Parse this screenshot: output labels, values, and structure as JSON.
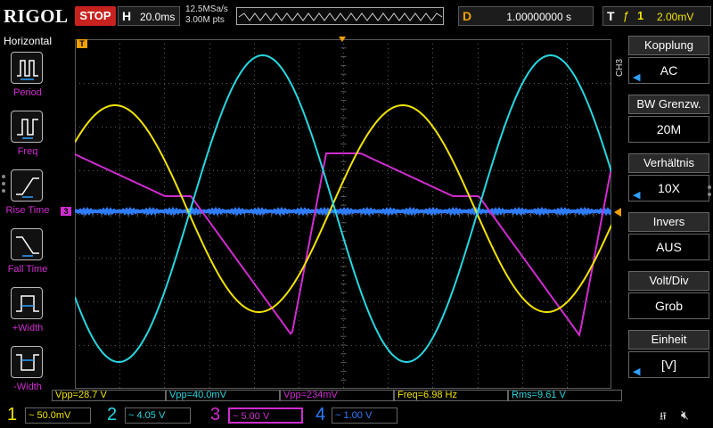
{
  "brand": "RIGOL",
  "status": "STOP",
  "horizontal": {
    "key": "H",
    "timebase": "20.0ms"
  },
  "acquisition": {
    "sample_rate": "12.5MSa/s",
    "mem_depth": "3.00M pts"
  },
  "delay": {
    "key": "D",
    "value": "1.00000000 s"
  },
  "trigger": {
    "key": "T",
    "slope": "ƒ",
    "source": "1",
    "level": "2.00mV"
  },
  "left_menu": {
    "title": "Horizontal",
    "items": [
      {
        "label": "Period",
        "icon": "period-icon"
      },
      {
        "label": "Freq",
        "icon": "freq-icon"
      },
      {
        "label": "Rise Time",
        "icon": "rise-time-icon"
      },
      {
        "label": "Fall Time",
        "icon": "fall-time-icon"
      },
      {
        "label": "+Width",
        "icon": "positive-width-icon"
      },
      {
        "label": "-Width",
        "icon": "negative-width-icon"
      }
    ]
  },
  "right_menu": {
    "channel_tag": "CH3",
    "items": [
      {
        "title": "Kopplung",
        "value": "AC",
        "arrow": true
      },
      {
        "title": "BW Grenzw.",
        "value": "20M",
        "arrow": false
      },
      {
        "title": "Verhältnis",
        "value": "10X",
        "arrow": true
      },
      {
        "title": "Invers",
        "value": "AUS",
        "arrow": false
      },
      {
        "title": "Volt/Div",
        "value": "Grob",
        "arrow": false
      },
      {
        "title": "Einheit",
        "value": "[V]",
        "arrow": true
      }
    ]
  },
  "measurements": [
    {
      "text": "Vpp=28.7 V",
      "color": "#f2e300"
    },
    {
      "text": "Vpp=40.0mV",
      "color": "#27d7e0"
    },
    {
      "text": "Vpp=234mV",
      "color": "#d02cd0"
    },
    {
      "text": "Freq=6.98 Hz",
      "color": "#f2e300"
    },
    {
      "text": "Rms=9.61 V",
      "color": "#27d7e0"
    }
  ],
  "channels": [
    {
      "num": "1",
      "scale": "50.0mV",
      "color": "#f2e300"
    },
    {
      "num": "2",
      "scale": "4.05 V",
      "color": "#27d7e0"
    },
    {
      "num": "3",
      "scale": "5.00 V",
      "color": "#d02cd0"
    },
    {
      "num": "4",
      "scale": "1.00 V",
      "color": "#2e7dff"
    }
  ],
  "markers": {
    "trigger_pos": "T",
    "ch3_offset": "3"
  },
  "colors": {
    "ch1": "#f2e300",
    "ch2": "#27d7e0",
    "ch3": "#d02cd0",
    "ch4": "#2e7dff",
    "trigger": "#f2a000",
    "stop": "#c8221e",
    "grid": "#5a5a5a"
  }
}
